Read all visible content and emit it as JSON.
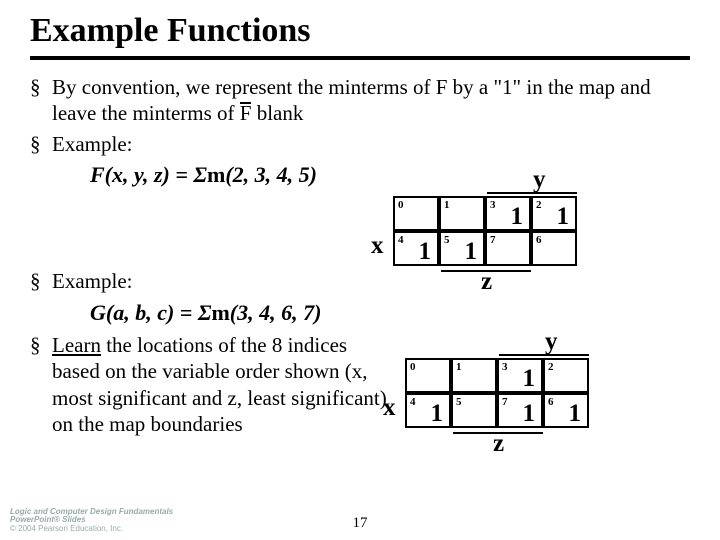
{
  "title": "Example Functions",
  "bullets": {
    "mark": "§",
    "b1a": "By convention, we represent the minterms of F by a \"1\" in the map and leave the minterms of ",
    "b1_fbar": "F",
    "b1b": " blank",
    "b2": "Example:",
    "b3": "Example:",
    "b4a": "Learn",
    "b4b": " the locations of the 8 indices based on the variable order shown (x, most significant and z, least significant) on the map boundaries"
  },
  "formula1": {
    "lhs": "F(x, y, z) = ",
    "sigma": "Σ",
    "m": "m",
    "args": "(2, 3, 4, 5)"
  },
  "formula2": {
    "lhs": "G(a, b, c) = ",
    "sigma": "Σ",
    "m": "m",
    "args": "(3, 4, 6, 7)"
  },
  "axes": {
    "x": "x",
    "y": "y",
    "z": "z"
  },
  "kmap1": {
    "cells": [
      {
        "idx": "0",
        "val": ""
      },
      {
        "idx": "1",
        "val": ""
      },
      {
        "idx": "3",
        "val": "1"
      },
      {
        "idx": "2",
        "val": "1"
      },
      {
        "idx": "4",
        "val": "1"
      },
      {
        "idx": "5",
        "val": "1"
      },
      {
        "idx": "7",
        "val": ""
      },
      {
        "idx": "6",
        "val": ""
      }
    ]
  },
  "kmap2": {
    "cells": [
      {
        "idx": "0",
        "val": ""
      },
      {
        "idx": "1",
        "val": ""
      },
      {
        "idx": "3",
        "val": "1"
      },
      {
        "idx": "2",
        "val": ""
      },
      {
        "idx": "4",
        "val": "1"
      },
      {
        "idx": "5",
        "val": ""
      },
      {
        "idx": "7",
        "val": "1"
      },
      {
        "idx": "6",
        "val": "1"
      }
    ]
  },
  "footer": {
    "l1": "Logic and Computer Design Fundamentals",
    "l2": "PowerPoint® Slides",
    "l3": "© 2004 Pearson Education, Inc."
  },
  "pagenum": "17"
}
